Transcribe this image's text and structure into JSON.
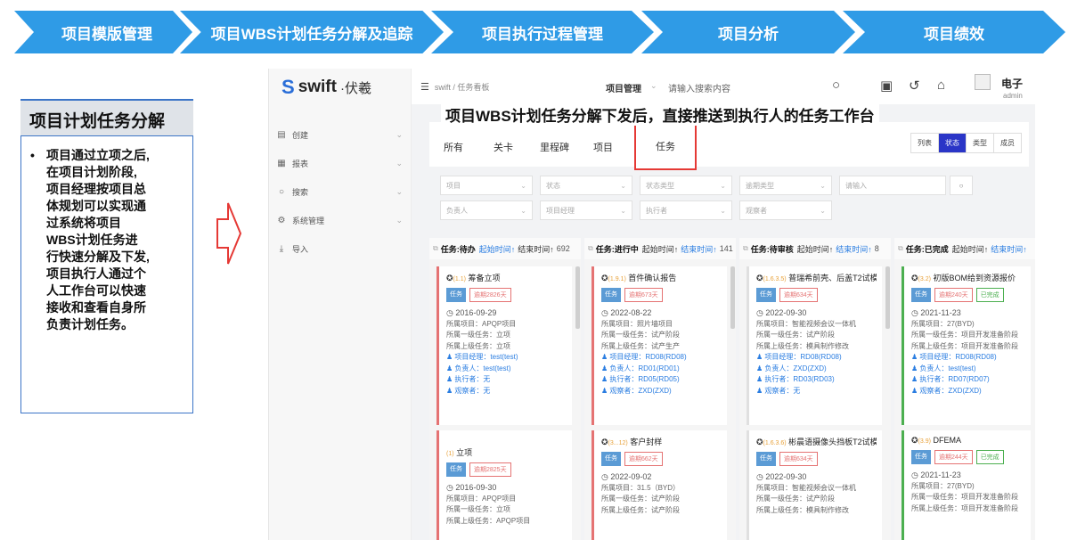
{
  "process": [
    "项目模版管理",
    "项目WBS计划任务分解及追踪",
    "项目执行过程管理",
    "项目分析",
    "项目绩效"
  ],
  "info": {
    "title": "项目计划任务分解",
    "lines": [
      "项目通过立项之后,",
      "在项目计划阶段,",
      "项目经理按项目总",
      "体规划可以实现通",
      "过系统将项目",
      "WBS计划任务进",
      "行快速分解及下发,",
      "项目执行人通过个",
      "人工作台可以快速",
      "接收和查看自身所",
      "负责计划任务。"
    ]
  },
  "banner": "项目WBS计划任务分解下发后，直接推送到执行人的任务工作台",
  "app": {
    "logo": {
      "mark": "S",
      "text": "swift",
      "sub": "·伏羲"
    },
    "menu": [
      {
        "icon": "▤",
        "label": "创建"
      },
      {
        "icon": "▦",
        "label": "报表"
      },
      {
        "icon": "○",
        "label": "搜索"
      },
      {
        "icon": "⚙",
        "label": "系统管理"
      },
      {
        "icon": "⤓",
        "label": "导入"
      }
    ],
    "breadcrumb": "swift / 任务看板",
    "top_menu": "项目管理",
    "search_placeholder": "请输入搜索内容",
    "user": {
      "name": "电子",
      "role": "admin"
    },
    "tabs": [
      "所有",
      "关卡",
      "里程碑",
      "项目"
    ],
    "active_tab": "任务",
    "views": [
      "列表",
      "状态",
      "类型",
      "成员"
    ],
    "active_view": "状态",
    "filters": {
      "project": "项目",
      "status": "状态",
      "status_type": "状态类型",
      "overdue_type": "逾期类型",
      "input": "请输入",
      "owner": "负责人",
      "pm": "项目经理",
      "executor": "执行者",
      "observer": "观察者"
    },
    "columns": [
      {
        "title": "任务:待办",
        "sort1": "起始时间↑",
        "sort2": "结束时间↑",
        "count": "692"
      },
      {
        "title": "任务:进行中",
        "sort1": "起始时间↑",
        "sort2": "结束时间↑",
        "count": "141"
      },
      {
        "title": "任务:待审核",
        "sort1": "起始时间↑",
        "sort2": "结束时间↑",
        "count": "8"
      },
      {
        "title": "任务:已完成",
        "sort1": "起始时间↑",
        "sort2": "结束时间↑",
        "count": ""
      }
    ],
    "cards": [
      {
        "code": "(1.1)",
        "name": "筹备立项",
        "tag": "任务",
        "overdue": "逾期2826天",
        "done": "",
        "date": "◷ 2016-09-29",
        "project": "所属项目：APQP项目",
        "l1": "所属一级任务：立项",
        "parent": "所属上级任务：立项",
        "pm": "♟ 项目经理：test(test)",
        "owner": "♟ 负责人：test(test)",
        "executor": "♟ 执行者：无",
        "observer": "♟ 观察者：无"
      },
      {
        "code": "(1.9.1)",
        "name": "首件确认报告",
        "tag": "任务",
        "overdue": "逾期673天",
        "done": "",
        "date": "◷ 2022-08-22",
        "project": "所属项目：照片墙项目",
        "l1": "所属一级任务：试产阶段",
        "parent": "所属上级任务：试产生产",
        "pm": "♟ 项目经理：RD08(RD08)",
        "owner": "♟ 负责人：RD01(RD01)",
        "executor": "♟ 执行者：RD05(RD05)",
        "observer": "♟ 观察者：ZXD(ZXD)"
      },
      {
        "code": "(1.6.3.5)",
        "name": "普瑞希前壳、后盖T2试模",
        "tag": "任务",
        "overdue": "逾期634天",
        "done": "",
        "date": "◷ 2022-09-30",
        "project": "所属项目：智能视频会议一体机",
        "l1": "所属一级任务：试产阶段",
        "parent": "所属上级任务：模具制作修改",
        "pm": "♟ 项目经理：RD08(RD08)",
        "owner": "♟ 负责人：ZXD(ZXD)",
        "executor": "♟ 执行者：RD03(RD03)",
        "observer": "♟ 观察者：无"
      },
      {
        "code": "(3.2)",
        "name": "初版BOM给到资源报价",
        "tag": "任务",
        "overdue": "逾期240天",
        "done": "已完成",
        "date": "◷ 2021-11-23",
        "project": "所属项目：27(BYD)",
        "l1": "所属一级任务：项目开发准备阶段",
        "parent": "所属上级任务：项目开发准备阶段",
        "pm": "♟ 项目经理：RD08(RD08)",
        "owner": "♟ 负责人：test(test)",
        "executor": "♟ 执行者：RD07(RD07)",
        "observer": "♟ 观察者：ZXD(ZXD)"
      },
      {
        "code": "(1)",
        "name": "立项",
        "tag": "任务",
        "overdue": "逾期2825天",
        "done": "",
        "date": "◷ 2016-09-30",
        "project": "所属项目：APQP项目",
        "l1": "所属一级任务：立项",
        "parent": "所属上级任务：APQP项目"
      },
      {
        "code": "(3...12)",
        "name": "客户封样",
        "tag": "任务",
        "overdue": "逾期662天",
        "done": "",
        "date": "◷ 2022-09-02",
        "project": "所属项目：31.5（BYD）",
        "l1": "所属一级任务：试产阶段",
        "parent": "所属上级任务：试产阶段"
      },
      {
        "code": "(1.6.3.6)",
        "name": "彬晨语摄像头挡板T2试模",
        "tag": "任务",
        "overdue": "逾期634天",
        "done": "",
        "date": "◷ 2022-09-30",
        "project": "所属项目：智能视频会议一体机",
        "l1": "所属一级任务：试产阶段",
        "parent": "所属上级任务：模具制作修改"
      },
      {
        "code": "(3.9)",
        "name": "DFEMA",
        "tag": "任务",
        "overdue": "逾期244天",
        "done": "已完成",
        "date": "◷ 2021-11-23",
        "project": "所属项目：27(BYD)",
        "l1": "所属一级任务：项目开发准备阶段",
        "parent": "所属上级任务：项目开发准备阶段"
      }
    ]
  }
}
